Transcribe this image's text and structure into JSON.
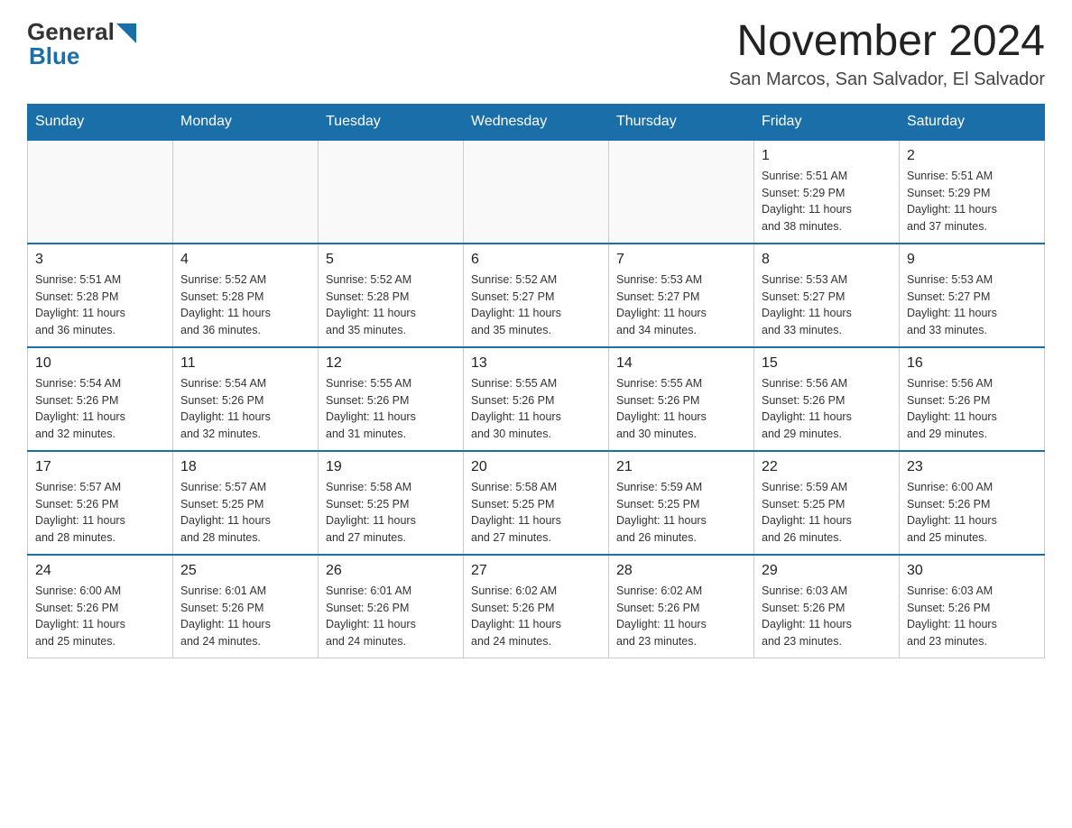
{
  "logo": {
    "general": "General",
    "blue": "Blue"
  },
  "header": {
    "title": "November 2024",
    "location": "San Marcos, San Salvador, El Salvador"
  },
  "columns": [
    "Sunday",
    "Monday",
    "Tuesday",
    "Wednesday",
    "Thursday",
    "Friday",
    "Saturday"
  ],
  "weeks": [
    [
      {
        "day": "",
        "info": ""
      },
      {
        "day": "",
        "info": ""
      },
      {
        "day": "",
        "info": ""
      },
      {
        "day": "",
        "info": ""
      },
      {
        "day": "",
        "info": ""
      },
      {
        "day": "1",
        "info": "Sunrise: 5:51 AM\nSunset: 5:29 PM\nDaylight: 11 hours\nand 38 minutes."
      },
      {
        "day": "2",
        "info": "Sunrise: 5:51 AM\nSunset: 5:29 PM\nDaylight: 11 hours\nand 37 minutes."
      }
    ],
    [
      {
        "day": "3",
        "info": "Sunrise: 5:51 AM\nSunset: 5:28 PM\nDaylight: 11 hours\nand 36 minutes."
      },
      {
        "day": "4",
        "info": "Sunrise: 5:52 AM\nSunset: 5:28 PM\nDaylight: 11 hours\nand 36 minutes."
      },
      {
        "day": "5",
        "info": "Sunrise: 5:52 AM\nSunset: 5:28 PM\nDaylight: 11 hours\nand 35 minutes."
      },
      {
        "day": "6",
        "info": "Sunrise: 5:52 AM\nSunset: 5:27 PM\nDaylight: 11 hours\nand 35 minutes."
      },
      {
        "day": "7",
        "info": "Sunrise: 5:53 AM\nSunset: 5:27 PM\nDaylight: 11 hours\nand 34 minutes."
      },
      {
        "day": "8",
        "info": "Sunrise: 5:53 AM\nSunset: 5:27 PM\nDaylight: 11 hours\nand 33 minutes."
      },
      {
        "day": "9",
        "info": "Sunrise: 5:53 AM\nSunset: 5:27 PM\nDaylight: 11 hours\nand 33 minutes."
      }
    ],
    [
      {
        "day": "10",
        "info": "Sunrise: 5:54 AM\nSunset: 5:26 PM\nDaylight: 11 hours\nand 32 minutes."
      },
      {
        "day": "11",
        "info": "Sunrise: 5:54 AM\nSunset: 5:26 PM\nDaylight: 11 hours\nand 32 minutes."
      },
      {
        "day": "12",
        "info": "Sunrise: 5:55 AM\nSunset: 5:26 PM\nDaylight: 11 hours\nand 31 minutes."
      },
      {
        "day": "13",
        "info": "Sunrise: 5:55 AM\nSunset: 5:26 PM\nDaylight: 11 hours\nand 30 minutes."
      },
      {
        "day": "14",
        "info": "Sunrise: 5:55 AM\nSunset: 5:26 PM\nDaylight: 11 hours\nand 30 minutes."
      },
      {
        "day": "15",
        "info": "Sunrise: 5:56 AM\nSunset: 5:26 PM\nDaylight: 11 hours\nand 29 minutes."
      },
      {
        "day": "16",
        "info": "Sunrise: 5:56 AM\nSunset: 5:26 PM\nDaylight: 11 hours\nand 29 minutes."
      }
    ],
    [
      {
        "day": "17",
        "info": "Sunrise: 5:57 AM\nSunset: 5:26 PM\nDaylight: 11 hours\nand 28 minutes."
      },
      {
        "day": "18",
        "info": "Sunrise: 5:57 AM\nSunset: 5:25 PM\nDaylight: 11 hours\nand 28 minutes."
      },
      {
        "day": "19",
        "info": "Sunrise: 5:58 AM\nSunset: 5:25 PM\nDaylight: 11 hours\nand 27 minutes."
      },
      {
        "day": "20",
        "info": "Sunrise: 5:58 AM\nSunset: 5:25 PM\nDaylight: 11 hours\nand 27 minutes."
      },
      {
        "day": "21",
        "info": "Sunrise: 5:59 AM\nSunset: 5:25 PM\nDaylight: 11 hours\nand 26 minutes."
      },
      {
        "day": "22",
        "info": "Sunrise: 5:59 AM\nSunset: 5:25 PM\nDaylight: 11 hours\nand 26 minutes."
      },
      {
        "day": "23",
        "info": "Sunrise: 6:00 AM\nSunset: 5:26 PM\nDaylight: 11 hours\nand 25 minutes."
      }
    ],
    [
      {
        "day": "24",
        "info": "Sunrise: 6:00 AM\nSunset: 5:26 PM\nDaylight: 11 hours\nand 25 minutes."
      },
      {
        "day": "25",
        "info": "Sunrise: 6:01 AM\nSunset: 5:26 PM\nDaylight: 11 hours\nand 24 minutes."
      },
      {
        "day": "26",
        "info": "Sunrise: 6:01 AM\nSunset: 5:26 PM\nDaylight: 11 hours\nand 24 minutes."
      },
      {
        "day": "27",
        "info": "Sunrise: 6:02 AM\nSunset: 5:26 PM\nDaylight: 11 hours\nand 24 minutes."
      },
      {
        "day": "28",
        "info": "Sunrise: 6:02 AM\nSunset: 5:26 PM\nDaylight: 11 hours\nand 23 minutes."
      },
      {
        "day": "29",
        "info": "Sunrise: 6:03 AM\nSunset: 5:26 PM\nDaylight: 11 hours\nand 23 minutes."
      },
      {
        "day": "30",
        "info": "Sunrise: 6:03 AM\nSunset: 5:26 PM\nDaylight: 11 hours\nand 23 minutes."
      }
    ]
  ]
}
